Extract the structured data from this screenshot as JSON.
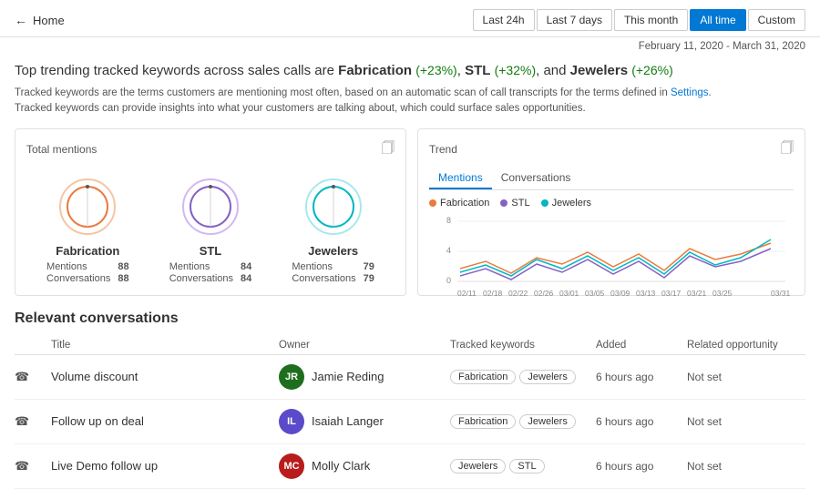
{
  "header": {
    "back_label": "Home",
    "filters": [
      {
        "id": "last24h",
        "label": "Last 24h",
        "active": false
      },
      {
        "id": "last7days",
        "label": "Last 7 days",
        "active": false
      },
      {
        "id": "thismonth",
        "label": "This month",
        "active": false
      },
      {
        "id": "alltime",
        "label": "All time",
        "active": true
      },
      {
        "id": "custom",
        "label": "Custom",
        "active": false
      }
    ]
  },
  "date_range": "February 11, 2020 - March 31, 2020",
  "headline": {
    "prefix": "Top trending tracked keywords across sales calls are ",
    "keyword1": "Fabrication",
    "pct1": "(+23%)",
    "separator1": ", ",
    "keyword2": "STL",
    "pct2": "(+32%)",
    "separator2": ", and ",
    "keyword3": "Jewelers",
    "pct3": "(+26%)"
  },
  "description_line1": "Tracked keywords are the terms customers are mentioning most often, based on an automatic scan of call transcripts for the terms defined in ",
  "settings_link": "Settings",
  "description_line2": ".",
  "description_line3": "Tracked keywords can provide insights into what your customers are talking about, which could surface sales opportunities.",
  "mentions_panel": {
    "title": "Total mentions",
    "items": [
      {
        "name": "Fabrication",
        "color": "#e97b3e",
        "mentions": 88,
        "conversations": 88,
        "circle_size": 68
      },
      {
        "name": "STL",
        "color": "#8661c5",
        "mentions": 84,
        "conversations": 84,
        "circle_size": 66
      },
      {
        "name": "Jewelers",
        "color": "#00b7c3",
        "mentions": 79,
        "conversations": 79,
        "circle_size": 62
      }
    ],
    "mentions_label": "Mentions",
    "conversations_label": "Conversations"
  },
  "trend_panel": {
    "title": "Trend",
    "tabs": [
      "Mentions",
      "Conversations"
    ],
    "active_tab": "Mentions",
    "legend": [
      {
        "name": "Fabrication",
        "color": "#e97b3e"
      },
      {
        "name": "STL",
        "color": "#8661c5"
      },
      {
        "name": "Jewelers",
        "color": "#00b7c3"
      }
    ],
    "x_labels": [
      "02/11",
      "02/18",
      "02/22",
      "02/26",
      "03/01",
      "03/05",
      "03/09",
      "03/13",
      "03/17",
      "03/21",
      "03/25",
      "03/31"
    ],
    "y_labels": [
      "8",
      "4",
      "0"
    ]
  },
  "conversations_section": {
    "title": "Relevant conversations",
    "columns": [
      "Title",
      "Owner",
      "Tracked keywords",
      "Added",
      "Related opportunity"
    ],
    "rows": [
      {
        "title": "Volume discount",
        "owner_initials": "JR",
        "owner_name": "Jamie Reding",
        "owner_color": "#1e6e1e",
        "keywords": [
          "Fabrication",
          "Jewelers"
        ],
        "added": "6 hours ago",
        "related": "Not set"
      },
      {
        "title": "Follow up on deal",
        "owner_initials": "IL",
        "owner_name": "Isaiah Langer",
        "owner_color": "#5b4bca",
        "keywords": [
          "Fabrication",
          "Jewelers"
        ],
        "added": "6 hours ago",
        "related": "Not set"
      },
      {
        "title": "Live Demo follow up",
        "owner_initials": "MC",
        "owner_name": "Molly Clark",
        "owner_color": "#b91c1c",
        "keywords": [
          "Jewelers",
          "STL"
        ],
        "added": "6 hours ago",
        "related": "Not set"
      }
    ]
  }
}
